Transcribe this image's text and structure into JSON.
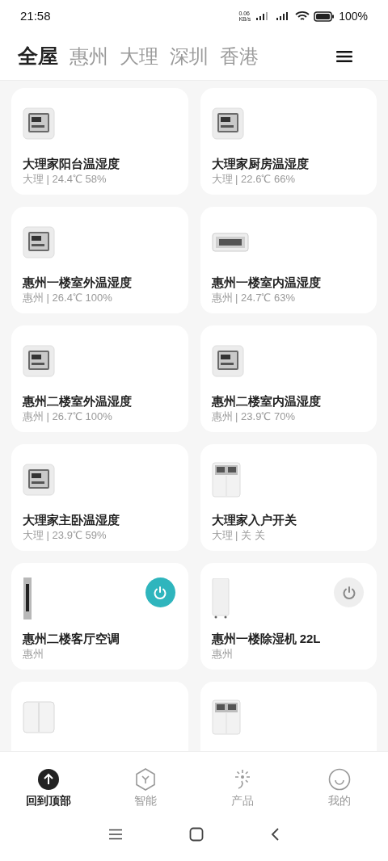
{
  "status_bar": {
    "time": "21:58",
    "net_speed": "0.06",
    "net_unit": "KB/s",
    "battery": "100%"
  },
  "tabs": [
    {
      "label": "全屋",
      "selected": true
    },
    {
      "label": "惠州",
      "selected": false
    },
    {
      "label": "大理",
      "selected": false
    },
    {
      "label": "深圳",
      "selected": false
    },
    {
      "label": "香港",
      "selected": false
    }
  ],
  "devices": [
    {
      "kind": "thermo",
      "name": "大理家阳台温湿度",
      "detail": "大理 | 24.4℃ 58%"
    },
    {
      "kind": "thermo",
      "name": "大理家厨房温湿度",
      "detail": "大理 | 22.6℃ 66%"
    },
    {
      "kind": "thermo",
      "name": "惠州一楼室外温湿度",
      "detail": "惠州 | 26.4℃ 100%"
    },
    {
      "kind": "clock",
      "name": "惠州一楼室内温湿度",
      "detail": "惠州 | 24.7℃ 63%"
    },
    {
      "kind": "thermo",
      "name": "惠州二楼室外温湿度",
      "detail": "惠州 | 26.7℃ 100%"
    },
    {
      "kind": "thermo",
      "name": "惠州二楼室内温湿度",
      "detail": "惠州 | 23.9℃ 70%"
    },
    {
      "kind": "thermo",
      "name": "大理家主卧温湿度",
      "detail": "大理 | 23.9℃ 59%"
    },
    {
      "kind": "panel",
      "name": "大理家入户开关",
      "detail": "大理 | 关 关"
    },
    {
      "kind": "ac",
      "name": "惠州二楼客厅空调",
      "detail": "惠州",
      "on": true
    },
    {
      "kind": "dehumidifier",
      "name": "惠州一楼除湿机 22L",
      "detail": "惠州",
      "on": false
    },
    {
      "kind": "switch"
    },
    {
      "kind": "panel"
    }
  ],
  "bottom_nav": [
    {
      "kind": "top",
      "label": "回到顶部",
      "selected": true
    },
    {
      "kind": "smart",
      "label": "智能",
      "selected": false
    },
    {
      "kind": "products",
      "label": "产品",
      "selected": false
    },
    {
      "kind": "me",
      "label": "我的",
      "selected": false
    }
  ]
}
